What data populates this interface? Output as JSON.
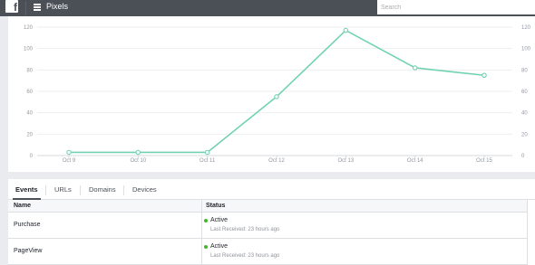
{
  "header": {
    "logo_letter": "f",
    "title": "Pixels",
    "search_placeholder": "Search"
  },
  "chart_data": {
    "type": "line",
    "categories": [
      "Oct 9",
      "Oct 10",
      "Oct 11",
      "Oct 12",
      "Oct 13",
      "Oct 14",
      "Oct 15"
    ],
    "values": [
      3,
      3,
      3,
      55,
      117,
      82,
      75
    ],
    "ylim": [
      0,
      120
    ],
    "yticks": [
      0,
      20,
      40,
      60,
      80,
      100,
      120
    ],
    "right_axis_ticks": [
      0,
      20,
      40,
      60,
      80,
      100,
      120
    ],
    "grid": true,
    "line_color": "#71d2b2"
  },
  "tabs": [
    {
      "label": "Events",
      "active": true
    },
    {
      "label": "URLs",
      "active": false
    },
    {
      "label": "Domains",
      "active": false
    },
    {
      "label": "Devices",
      "active": false
    }
  ],
  "table": {
    "columns": [
      "Name",
      "Status"
    ],
    "rows": [
      {
        "name": "Purchase",
        "status": "Active",
        "detail": "Last Received: 23 hours ago"
      },
      {
        "name": "PageView",
        "status": "Active",
        "detail": "Last Received: 23 hours ago"
      }
    ]
  },
  "colors": {
    "topbar": "#4b4f56",
    "active_status": "#42b72a"
  }
}
